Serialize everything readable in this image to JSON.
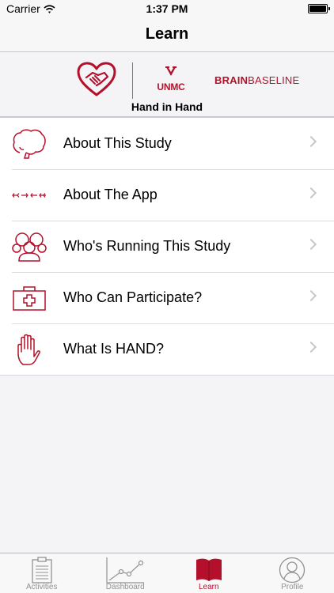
{
  "status_bar": {
    "carrier": "Carrier",
    "time": "1:37 PM"
  },
  "nav": {
    "title": "Learn"
  },
  "header": {
    "unmc_logo_text": "UNMC",
    "brainbaseline_bold": "BRAIN",
    "brainbaseline_rest": "BASELINE",
    "app_name": "Hand in Hand"
  },
  "menu": {
    "items": [
      {
        "label": "About This Study",
        "icon": "brain-icon"
      },
      {
        "label": "About The App",
        "icon": "arrows-icon"
      },
      {
        "label": "Who's Running This Study",
        "icon": "team-icon"
      },
      {
        "label": "Who Can Participate?",
        "icon": "medical-kit-icon"
      },
      {
        "label": "What Is HAND?",
        "icon": "hand-icon"
      }
    ]
  },
  "tabs": [
    {
      "label": "Activities",
      "icon": "clipboard-icon"
    },
    {
      "label": "Dashboard",
      "icon": "line-chart-icon"
    },
    {
      "label": "Learn",
      "icon": "book-icon",
      "active": true
    },
    {
      "label": "Profile",
      "icon": "profile-icon"
    }
  ],
  "colors": {
    "accent": "#b5102b",
    "tab_inactive": "#929292",
    "chevron": "#c7c7cc"
  }
}
